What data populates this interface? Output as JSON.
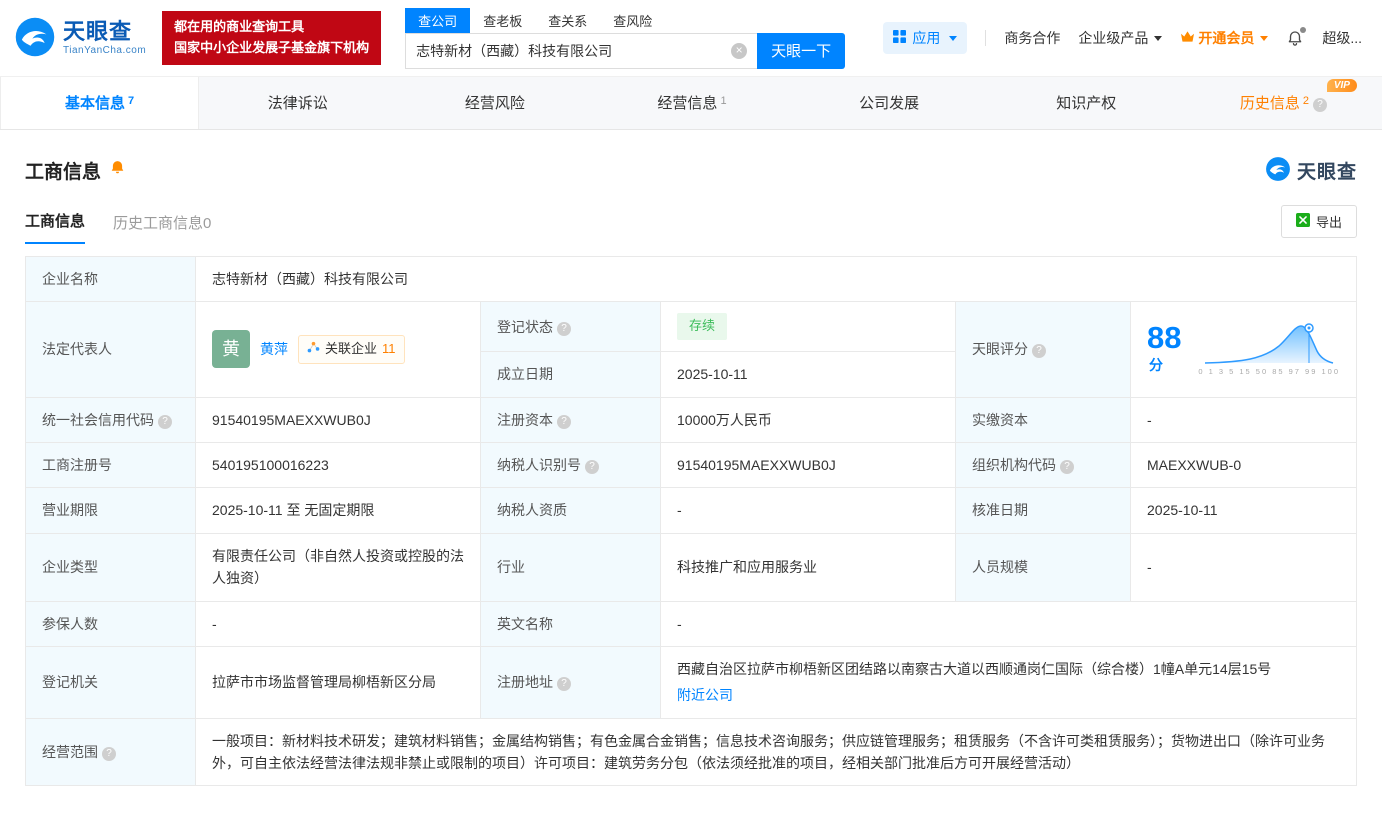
{
  "header": {
    "logo": {
      "title": "天眼查",
      "subtitle": "TianYanCha.com"
    },
    "banner": {
      "line1": "都在用的商业查询工具",
      "line2": "国家中小企业发展子基金旗下机构"
    },
    "search": {
      "tab_company": "查公司",
      "tab_boss": "查老板",
      "tab_relation": "查关系",
      "tab_risk": "查风险",
      "value": "志特新材（西藏）科技有限公司",
      "button": "天眼一下"
    },
    "menu": {
      "apps": "应用",
      "cooperation": "商务合作",
      "enterprise": "企业级产品",
      "vip": "开通会员",
      "account": "超级..."
    }
  },
  "tabs": {
    "basic": "基本信息",
    "basic_count": "7",
    "legal": "法律诉讼",
    "risk": "经营风险",
    "business": "经营信息",
    "business_count": "1",
    "development": "公司发展",
    "ip": "知识产权",
    "history": "历史信息",
    "history_count": "2",
    "history_vip": "VIP"
  },
  "section": {
    "title": "工商信息",
    "brand": "天眼查",
    "tab_current": "工商信息",
    "tab_history": "历史工商信息0",
    "export": "导出"
  },
  "table": {
    "company_name": {
      "label": "企业名称",
      "value": "志特新材（西藏）科技有限公司"
    },
    "legal_rep": {
      "label": "法定代表人",
      "avatar": "黄",
      "name": "黄萍",
      "related_label": "关联企业",
      "related_count": "11"
    },
    "reg_status": {
      "label": "登记状态",
      "value": "存续"
    },
    "score": {
      "label": "天眼评分",
      "value": "88",
      "unit": "分",
      "axis": "0 1 3 5 15 50 85 97 99 100"
    },
    "establish_date": {
      "label": "成立日期",
      "value": "2025-10-11"
    },
    "credit_code": {
      "label": "统一社会信用代码",
      "value": "91540195MAEXXWUB0J"
    },
    "reg_capital": {
      "label": "注册资本",
      "value": "10000万人民币"
    },
    "paid_capital": {
      "label": "实缴资本",
      "value": "-"
    },
    "reg_number": {
      "label": "工商注册号",
      "value": "540195100016223"
    },
    "taxpayer_id": {
      "label": "纳税人识别号",
      "value": "91540195MAEXXWUB0J"
    },
    "org_code": {
      "label": "组织机构代码",
      "value": "MAEXXWUB-0"
    },
    "business_term": {
      "label": "营业期限",
      "value": "2025-10-11 至 无固定期限"
    },
    "taxpayer_quality": {
      "label": "纳税人资质",
      "value": "-"
    },
    "approval_date": {
      "label": "核准日期",
      "value": "2025-10-11"
    },
    "company_type": {
      "label": "企业类型",
      "value": "有限责任公司（非自然人投资或控股的法人独资）"
    },
    "industry": {
      "label": "行业",
      "value": "科技推广和应用服务业"
    },
    "staff_size": {
      "label": "人员规模",
      "value": "-"
    },
    "insured_count": {
      "label": "参保人数",
      "value": "-"
    },
    "english_name": {
      "label": "英文名称",
      "value": "-"
    },
    "reg_authority": {
      "label": "登记机关",
      "value": "拉萨市市场监督管理局柳梧新区分局"
    },
    "reg_address": {
      "label": "注册地址",
      "value": "西藏自治区拉萨市柳梧新区团结路以南察古大道以西顺通岗仁国际（综合楼）1幢A单元14层15号",
      "link": "附近公司"
    },
    "business_scope": {
      "label": "经营范围",
      "value": "一般项目：新材料技术研发；建筑材料销售；金属结构销售；有色金属合金销售；信息技术咨询服务；供应链管理服务；租赁服务（不含许可类租赁服务）；货物进出口（除许可业务外，可自主依法经营法律法规非禁止或限制的项目）许可项目：建筑劳务分包（依法须经批准的项目，经相关部门批准后方可开展经营活动）"
    }
  }
}
